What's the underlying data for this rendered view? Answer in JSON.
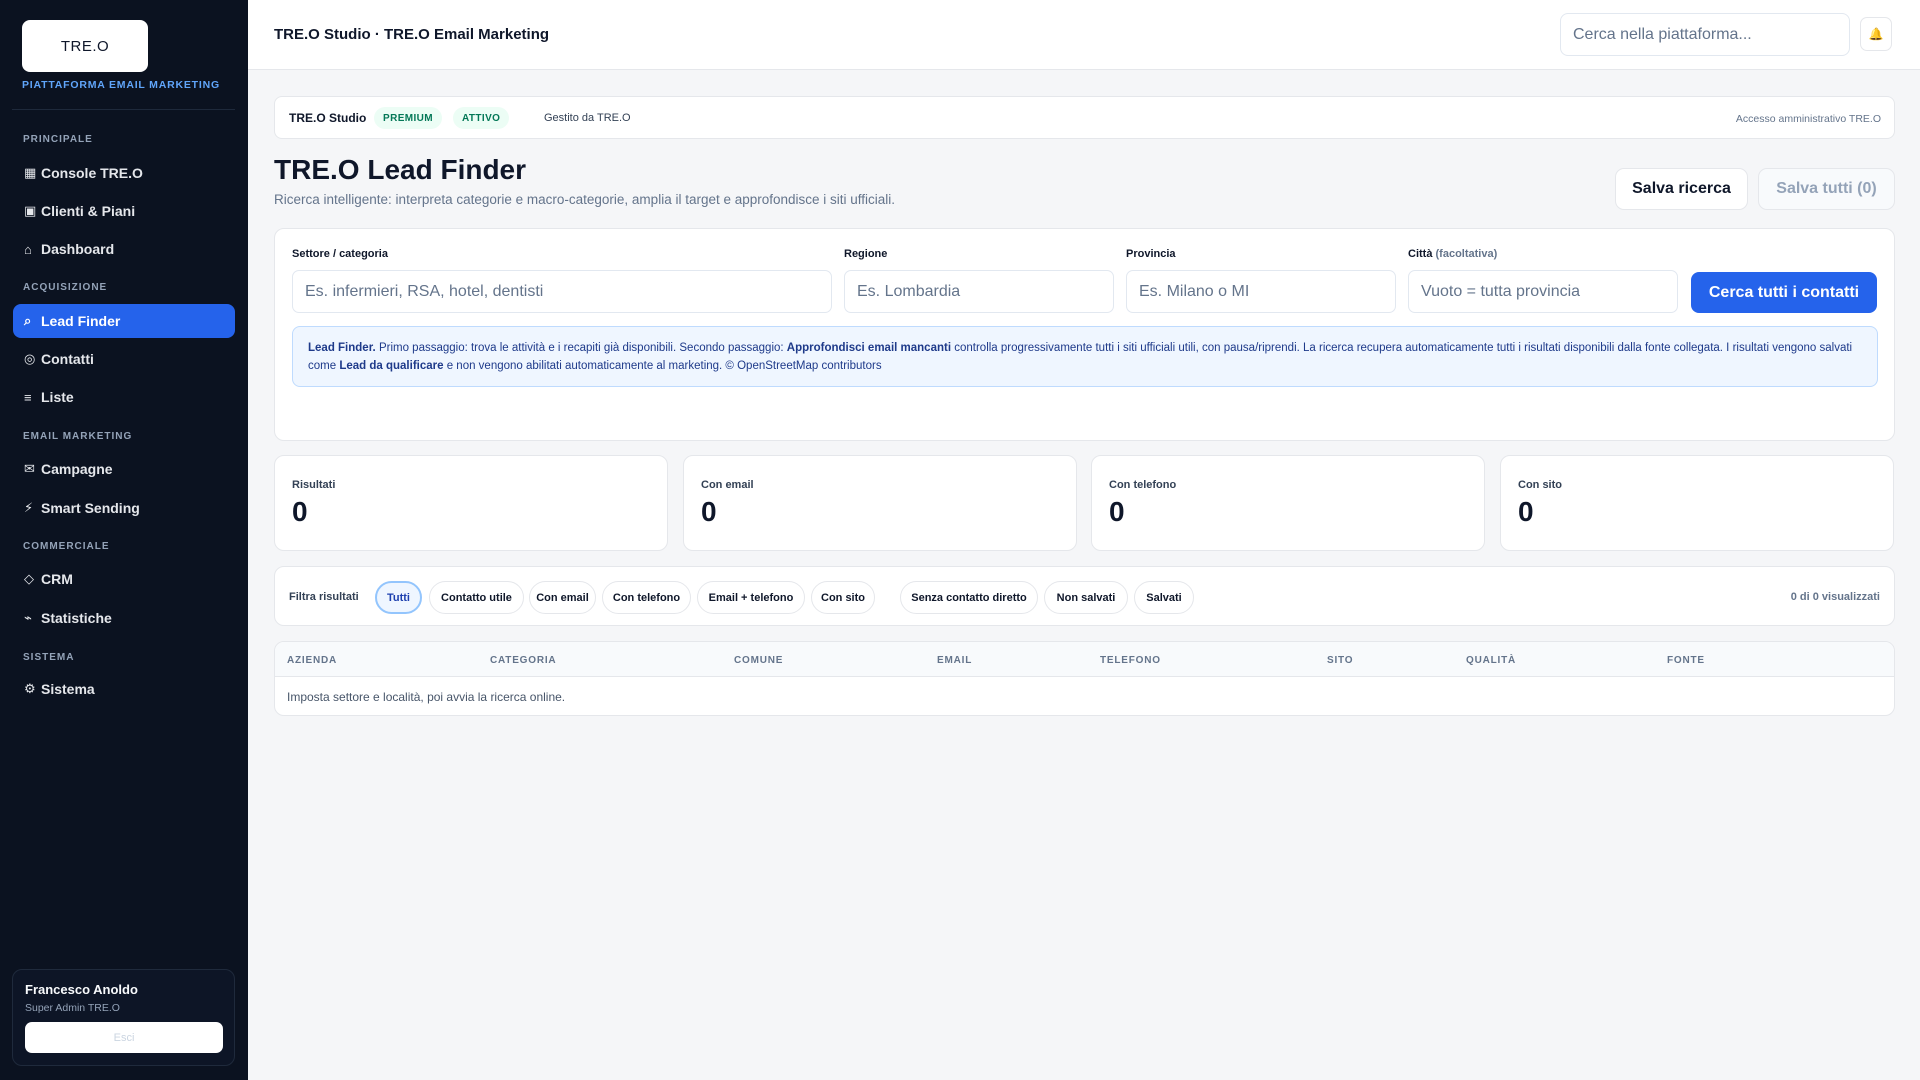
{
  "brand": {
    "logo_text": "TRE.O",
    "subtitle": "PIATTAFORMA EMAIL MARKETING"
  },
  "sidebar": {
    "sections": [
      {
        "label": "PRINCIPALE"
      },
      {
        "label": "ACQUISIZIONE"
      },
      {
        "label": "EMAIL MARKETING"
      },
      {
        "label": "COMMERCIALE"
      },
      {
        "label": "SISTEMA"
      }
    ],
    "items": [
      {
        "icon": "▦",
        "label": "Console TRE.O",
        "icon_name": "grid-icon"
      },
      {
        "icon": "▣",
        "label": "Clienti & Piani",
        "icon_name": "box-icon"
      },
      {
        "icon": "⌂",
        "label": "Dashboard",
        "icon_name": "home-icon"
      },
      {
        "icon": "⌕",
        "label": "Lead Finder",
        "icon_name": "search-icon",
        "active": true
      },
      {
        "icon": "◎",
        "label": "Contatti",
        "icon_name": "target-icon"
      },
      {
        "icon": "≡",
        "label": "Liste",
        "icon_name": "list-icon"
      },
      {
        "icon": "✉",
        "label": "Campagne",
        "icon_name": "mail-icon"
      },
      {
        "icon": "⚡",
        "label": "Smart Sending",
        "icon_name": "lightning-icon"
      },
      {
        "icon": "◇",
        "label": "CRM",
        "icon_name": "diamond-icon"
      },
      {
        "icon": "⌁",
        "label": "Statistiche",
        "icon_name": "chart-icon"
      },
      {
        "icon": "⚙",
        "label": "Sistema",
        "icon_name": "gear-icon"
      }
    ]
  },
  "user": {
    "name": "Francesco Anoldo",
    "role": "Super Admin TRE.O",
    "logout_label": "Esci"
  },
  "header": {
    "title": "TRE.O Studio · TRE.O Email Marketing",
    "search_placeholder": "Cerca nella piattaforma...",
    "bell_icon": "🔔"
  },
  "tenant": {
    "name": "TRE.O Studio",
    "plan_badge": "PREMIUM",
    "status_badge": "ATTIVO",
    "managed_by": "Gestito da TRE.O",
    "access_note": "Accesso amministrativo TRE.O"
  },
  "page": {
    "title": "TRE.O Lead Finder",
    "subtitle": "Ricerca intelligente: interpreta categorie e macro-categorie, amplia il target e approfondisce i siti ufficiali.",
    "save_search_label": "Salva ricerca",
    "save_all_label": "Salva tutti (0)"
  },
  "search_form": {
    "sector_label": "Settore / categoria",
    "sector_placeholder": "Es. infermieri, RSA, hotel, dentisti",
    "region_label": "Regione",
    "region_placeholder": "Es. Lombardia",
    "province_label": "Provincia",
    "province_placeholder": "Es. Milano o MI",
    "city_label": "Città",
    "city_optional": "(facoltativa)",
    "city_placeholder": "Vuoto = tutta provincia",
    "search_button": "Cerca tutti i contatti"
  },
  "info": {
    "lead_finder": "Lead Finder.",
    "text1": " Primo passaggio: trova le attività e i recapiti già disponibili. Secondo passaggio: ",
    "deepen": "Approfondisci email mancanti",
    "text2": " controlla progressivamente tutti i siti ufficiali utili, con pausa/riprendi. La ricerca recupera automaticamente tutti i risultati disponibili dalla fonte collegata. I risultati vengono salvati come ",
    "to_qualify": "Lead da qualificare",
    "text3": " e non vengono abilitati automaticamente al marketing. © OpenStreetMap contributors"
  },
  "stats": [
    {
      "label": "Risultati",
      "value": "0"
    },
    {
      "label": "Con email",
      "value": "0"
    },
    {
      "label": "Con telefono",
      "value": "0"
    },
    {
      "label": "Con sito",
      "value": "0"
    }
  ],
  "filters": {
    "label": "Filtra risultati",
    "chips": [
      "Tutti",
      "Contatto utile",
      "Con email",
      "Con telefono",
      "Email + telefono",
      "Con sito",
      "Senza contatto diretto",
      "Non salvati",
      "Salvati"
    ],
    "active": "Tutti",
    "count": "0 di 0 visualizzati"
  },
  "table": {
    "columns": [
      "AZIENDA",
      "CATEGORIA",
      "COMUNE",
      "EMAIL",
      "TELEFONO",
      "SITO",
      "QUALITÀ",
      "FONTE"
    ],
    "empty_message": "Imposta settore e località, poi avvia la ricerca online."
  },
  "colors": {
    "accent": "#2563eb",
    "sidebar_bg": "#0b1220",
    "badge_green": "#047857"
  }
}
